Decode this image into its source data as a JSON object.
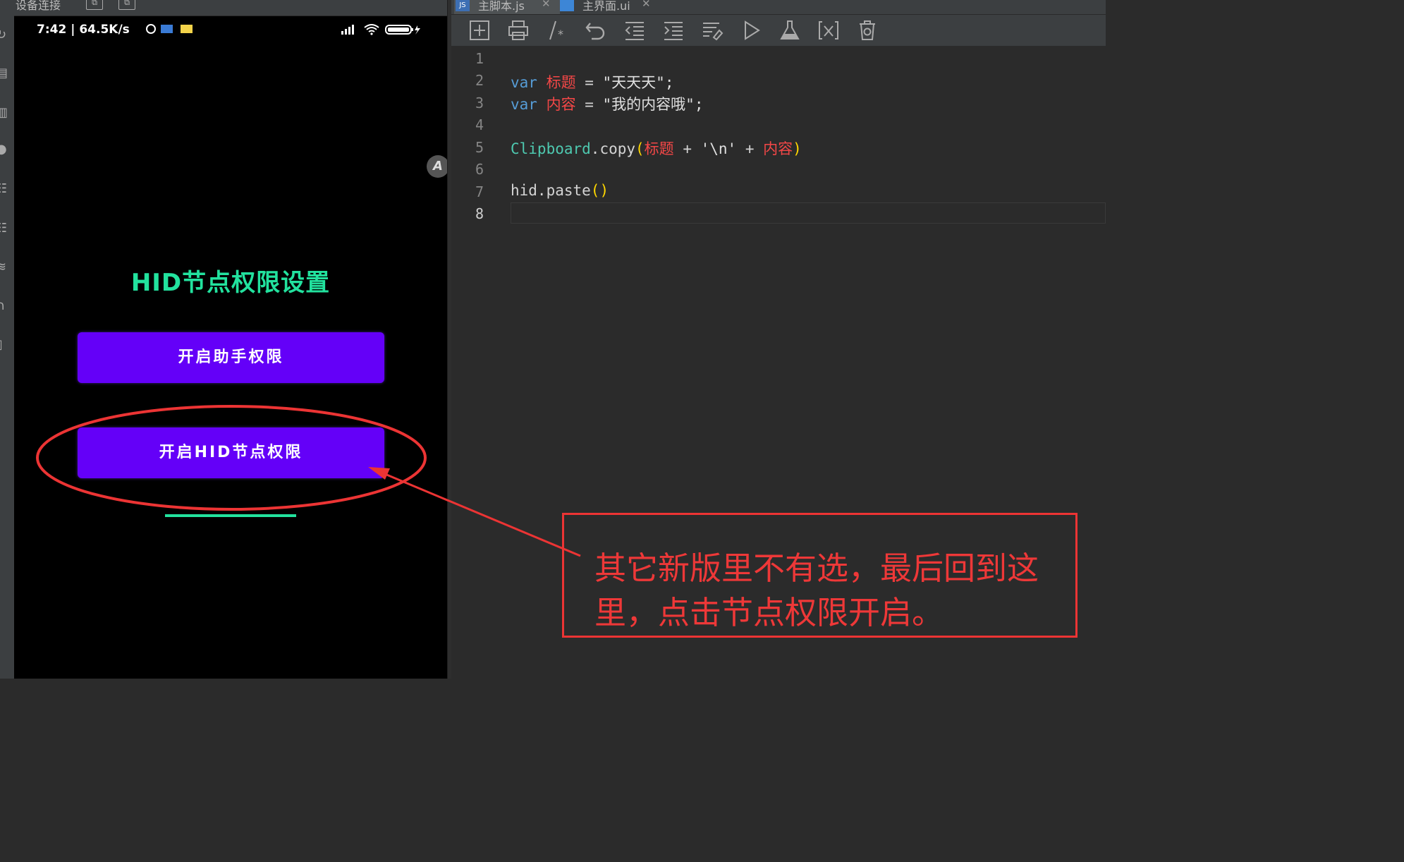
{
  "left_panel": {
    "title": "设备连接",
    "title_icons": [
      "window-icon",
      "window-icon"
    ],
    "sidebar_icons": [
      "refresh-icon",
      "apk-icon",
      "file-icon",
      "palette-icon",
      "node-tree-icon",
      "node-tree-icon",
      "wifi-icon",
      "usb-icon",
      "device-icon"
    ]
  },
  "phone": {
    "status_time": "7:42 | 64.5K/s",
    "heading": "HID节点权限设置",
    "btn_assist": "开启助手权限",
    "btn_hid": "开启HID节点权限",
    "accent_color": "#22e29e",
    "button_color": "#6400f8"
  },
  "tabs": [
    {
      "label": "主脚本.js",
      "icon": "js-file-icon"
    },
    {
      "label": "主界面.ui",
      "icon": "ui-file-icon"
    }
  ],
  "toolbar_icons": [
    "new-file-icon",
    "print-icon",
    "comment-icon",
    "undo-icon",
    "outdent-icon",
    "indent-icon",
    "format-icon",
    "run-icon",
    "flask-icon",
    "variable-icon",
    "clear-icon"
  ],
  "editor": {
    "line_numbers": [
      "1",
      "2",
      "3",
      "4",
      "5",
      "6",
      "7",
      "8"
    ],
    "line2": {
      "kw": "var",
      "name": "标题",
      "eq": " = ",
      "str": "\"天天天\";"
    },
    "line3": {
      "kw": "var",
      "name": "内容",
      "eq": " = ",
      "str": "\"我的内容哦\";"
    },
    "line5": {
      "cls": "Clipboard",
      "method": ".copy",
      "open": "(",
      "a": "标题",
      "plus1": " + ",
      "nl": "'\\n'",
      "plus2": " + ",
      "b": "内容",
      "close": ")"
    },
    "line7": {
      "call": "hid.paste",
      "parens": "()"
    }
  },
  "annotation": {
    "text": "其它新版里不有选，最后回到这里，点击节点权限开启。",
    "color": "#ec3434"
  }
}
